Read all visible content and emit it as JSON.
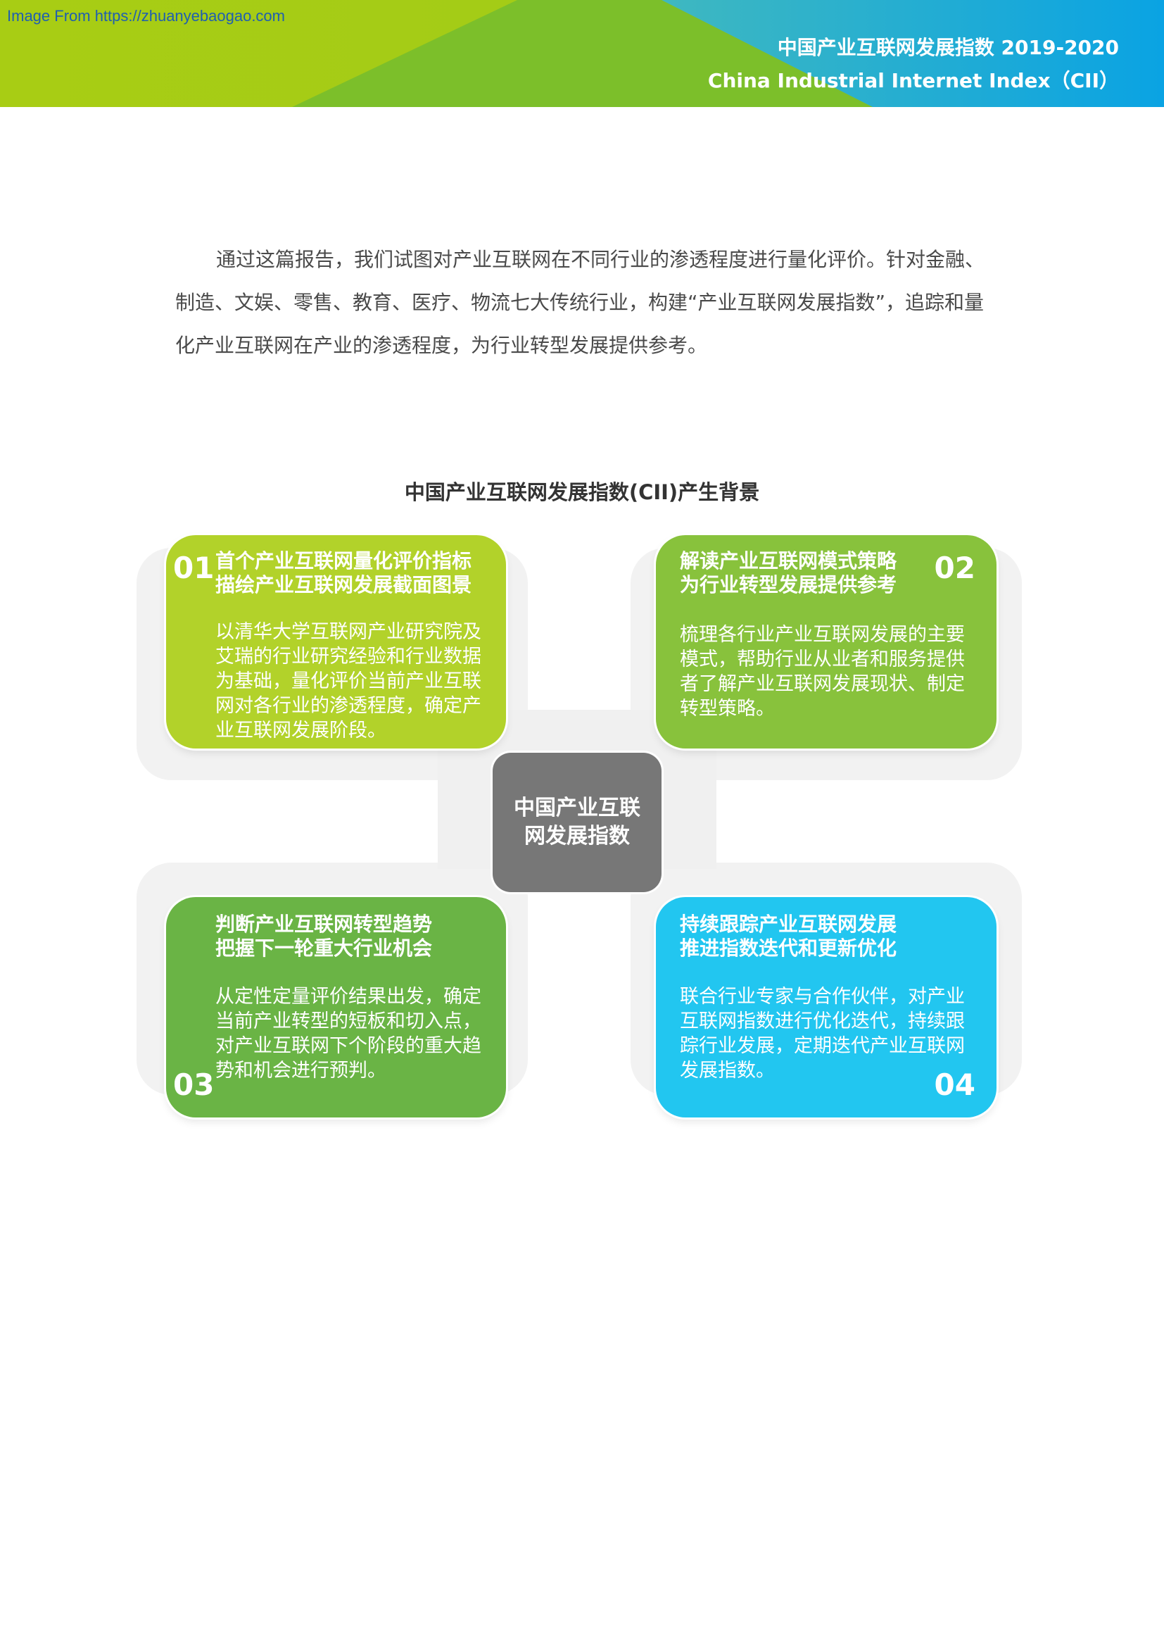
{
  "watermark": "Image From https://zhuanyebaogao.com",
  "header": {
    "title": "中国产业互联网发展指数 2019-2020",
    "subtitle": "China Industrial Internet Index（CII）",
    "colors": {
      "lime": "#a8cd14",
      "green": "#7cbf2a",
      "blue": "#0aa7e0"
    }
  },
  "intro": {
    "text": "通过这篇报告，我们试图对产业互联网在不同行业的渗透程度进行量化评价。针对金融、制造、文娱、零售、教育、医疗、物流七大传统行业，构建“产业互联网发展指数”，追踪和量化产业互联网在产业的渗透程度，为行业转型发展提供参考。"
  },
  "diagram": {
    "title": "中国产业互联网发展指数(CII)产生背景",
    "center": "中国产业互联网发展指数",
    "cards": [
      {
        "number": "01",
        "heading": "首个产业互联网量化评价指标\n描绘产业互联网发展截面图景",
        "body": "以清华大学互联网产业研究院及艾瑞的行业研究经验和行业数据为基础，量化评价当前产业互联网对各行业的渗透程度，确定产业互联网发展阶段。",
        "color": "#b2d22a"
      },
      {
        "number": "02",
        "heading": "解读产业互联网模式策略\n为行业转型发展提供参考",
        "body": "梳理各行业产业互联网发展的主要模式，帮助行业从业者和服务提供者了解产业互联网发展现状、制定转型策略。",
        "color": "#88c23c"
      },
      {
        "number": "03",
        "heading": "判断产业互联网转型趋势\n把握下一轮重大行业机会",
        "body": "从定性定量评价结果出发，确定当前产业转型的短板和切入点，对产业互联网下个阶段的重大趋势和机会进行预判。",
        "color": "#6ab445"
      },
      {
        "number": "04",
        "heading": "持续跟踪产业互联网发展\n推进指数迭代和更新优化",
        "body": "联合行业专家与合作伙伴，对产业互联网指数进行优化迭代，持续跟踪行业发展，定期迭代产业互联网发展指数。",
        "color": "#22c6f0"
      }
    ]
  }
}
